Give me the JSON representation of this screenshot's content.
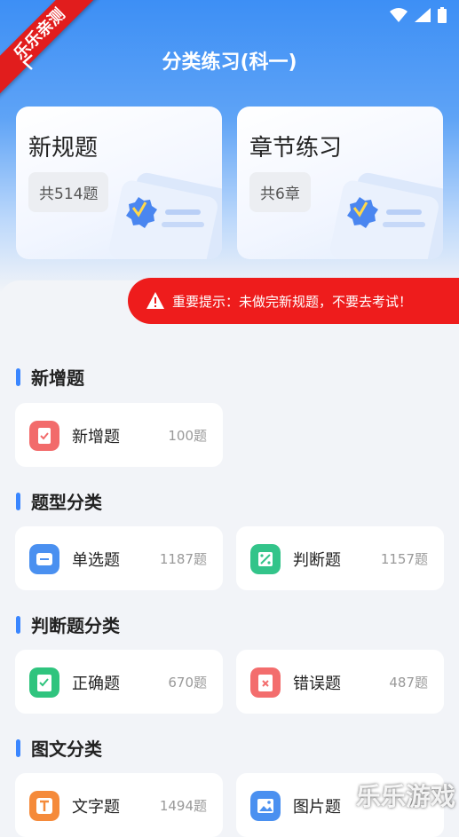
{
  "watermark_ribbon": "乐乐亲测",
  "header": {
    "title": "分类练习(科一)"
  },
  "cards": [
    {
      "title": "新规题",
      "count": "共514题"
    },
    {
      "title": "章节练习",
      "count": "共6章"
    }
  ],
  "warning": {
    "text": "重要提示：未做完新规题，不要去考试！"
  },
  "sections": {
    "new": {
      "title": "新增题"
    },
    "type": {
      "title": "题型分类"
    },
    "judge": {
      "title": "判断题分类"
    },
    "media": {
      "title": "图文分类"
    }
  },
  "items": {
    "new_q": {
      "label": "新增题",
      "count": "100题",
      "color": "#f26b6b"
    },
    "single": {
      "label": "单选题",
      "count": "1187题",
      "color": "#4a90f0"
    },
    "judge": {
      "label": "判断题",
      "count": "1157题",
      "color": "#33c48a"
    },
    "correct": {
      "label": "正确题",
      "count": "670题",
      "color": "#2fc47e"
    },
    "wrong": {
      "label": "错误题",
      "count": "487题",
      "color": "#f36d6d"
    },
    "text": {
      "label": "文字题",
      "count": "1494题",
      "color": "#f58a3a"
    },
    "image": {
      "label": "图片题",
      "count": "",
      "color": "#4a90f0"
    }
  },
  "corner_watermark": "乐乐游戏"
}
